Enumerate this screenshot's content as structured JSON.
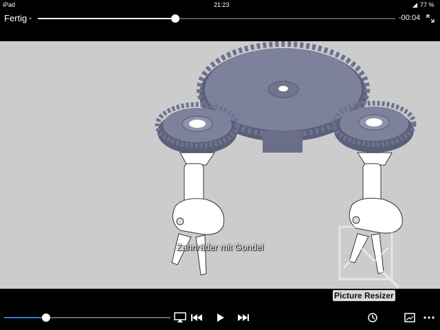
{
  "status_bar": {
    "device": "iPad",
    "time": "21:23",
    "battery": "77 %"
  },
  "player": {
    "done_label": "Fertig",
    "progress": 0.385,
    "time_remaining": "-00:04",
    "volume": 0.25
  },
  "video": {
    "subtitle": "Zahnräder mit Gondel",
    "watermark": "Picture Resizer"
  },
  "controls": {
    "icons": [
      "airplay-icon",
      "skip-back-icon",
      "play-icon",
      "skip-forward-icon",
      "speed-icon",
      "picture-in-picture-icon",
      "more-icon"
    ]
  },
  "colors": {
    "volume_accent": "#2f7bd6",
    "background": "#000000",
    "video_bg": "#cccccc",
    "gear": "#7d819c"
  }
}
